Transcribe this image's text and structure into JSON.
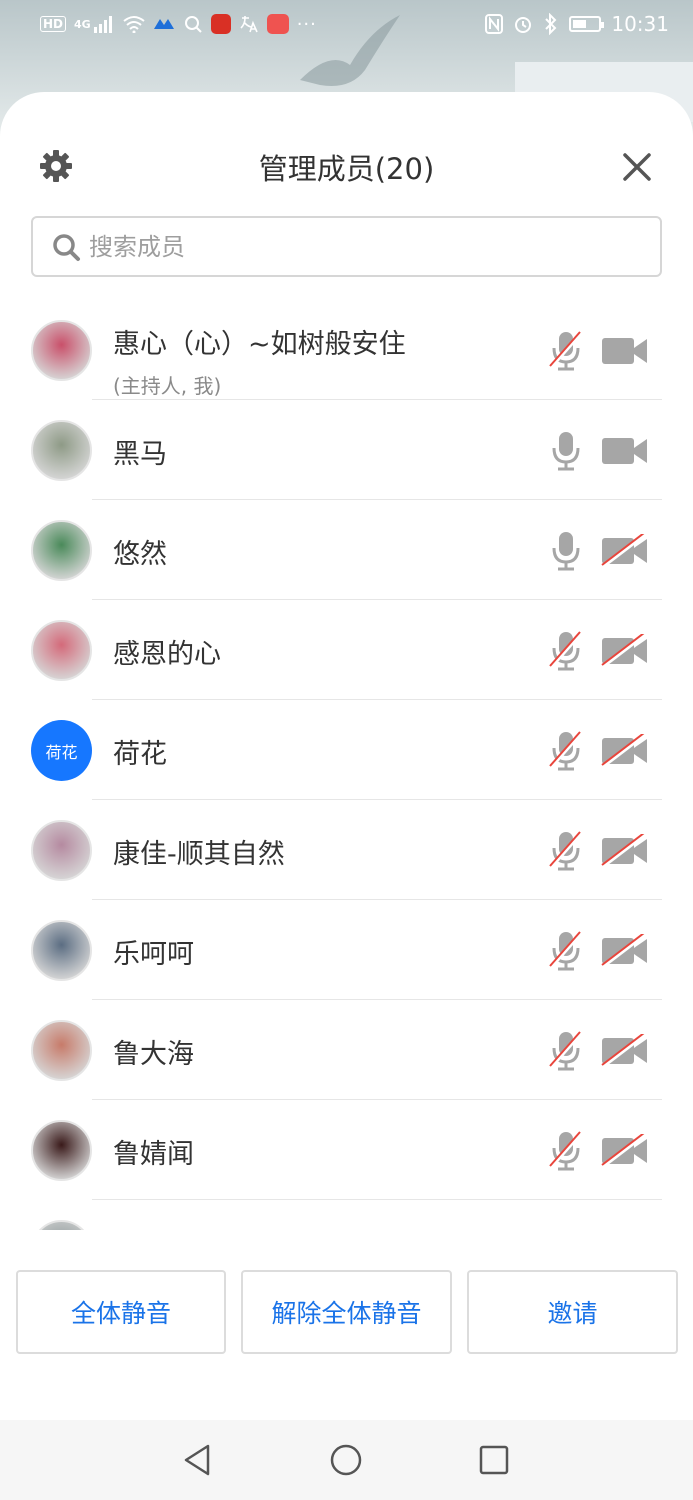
{
  "status_bar": {
    "left_badges": [
      "HD",
      "4G"
    ],
    "time": "10:31",
    "battery_level": 0.45,
    "icons": [
      "hd-icon",
      "signal-icon",
      "wifi-icon",
      "meeting-app-icon",
      "search-app-icon",
      "video-app-icon",
      "translate-icon",
      "huawei-app-icon",
      "more-icon",
      "nfc-icon",
      "alarm-icon",
      "bluetooth-icon",
      "battery-icon"
    ]
  },
  "header": {
    "title": "管理成员(20)",
    "settings_icon": "gear-icon",
    "close_icon": "close-icon"
  },
  "search": {
    "placeholder": "搜索成员",
    "icon": "search-icon"
  },
  "members": [
    {
      "name": "惠心（心）~如树般安住",
      "sub": "(主持人, 我)",
      "avatar": "photo",
      "mic_muted": true,
      "cam_off": false
    },
    {
      "name": "黑马",
      "sub": "",
      "avatar": "photo",
      "mic_muted": false,
      "cam_off": false
    },
    {
      "name": "悠然",
      "sub": "",
      "avatar": "photo",
      "mic_muted": false,
      "cam_off": true
    },
    {
      "name": "感恩的心",
      "sub": "",
      "avatar": "photo",
      "mic_muted": true,
      "cam_off": true
    },
    {
      "name": "荷花",
      "sub": "",
      "avatar": "text",
      "avatar_text": "荷花",
      "mic_muted": true,
      "cam_off": true
    },
    {
      "name": "康佳-顺其自然",
      "sub": "",
      "avatar": "photo",
      "mic_muted": true,
      "cam_off": true
    },
    {
      "name": "乐呵呵",
      "sub": "",
      "avatar": "photo",
      "mic_muted": true,
      "cam_off": true
    },
    {
      "name": "鲁大海",
      "sub": "",
      "avatar": "photo",
      "mic_muted": true,
      "cam_off": true
    },
    {
      "name": "鲁婧闻",
      "sub": "",
      "avatar": "photo",
      "mic_muted": true,
      "cam_off": true
    }
  ],
  "buttons": {
    "mute_all": "全体静音",
    "unmute_all": "解除全体静音",
    "invite": "邀请"
  },
  "colors": {
    "accent_blue": "#1a73e8",
    "avatar_blue": "#1677ff",
    "muted_red": "#e8453c",
    "icon_gray": "#a6a6a6",
    "title_text": "#333333"
  },
  "nav_bar": {
    "icons": [
      "back-icon",
      "home-icon",
      "recents-icon"
    ]
  }
}
